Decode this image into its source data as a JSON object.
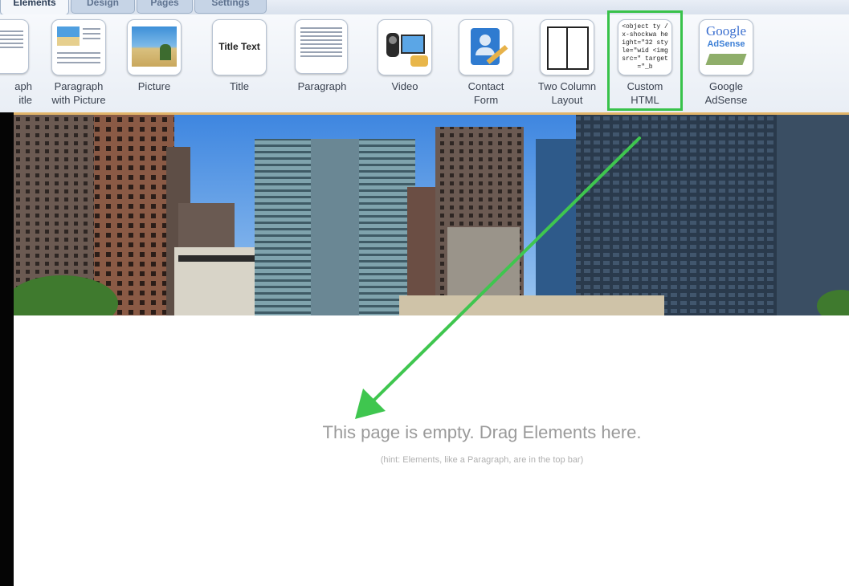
{
  "tabs": [
    "Elements",
    "Design",
    "Pages",
    "Settings"
  ],
  "toolbar": {
    "items": [
      {
        "label_1": "aph",
        "label_2": "itle",
        "icon": "paragraph-with-title-icon"
      },
      {
        "label_1": "Paragraph",
        "label_2": "with Picture",
        "icon": "paragraph-with-picture-icon"
      },
      {
        "label_1": "Picture",
        "label_2": "",
        "icon": "picture-icon"
      },
      {
        "label_1": "Title",
        "label_2": "",
        "icon": "title-icon",
        "thumb_text": "Title Text"
      },
      {
        "label_1": "Paragraph",
        "label_2": "",
        "icon": "paragraph-icon"
      },
      {
        "label_1": "Video",
        "label_2": "",
        "icon": "video-camera-icon"
      },
      {
        "label_1": "Contact",
        "label_2": "Form",
        "icon": "contact-form-icon"
      },
      {
        "label_1": "Two Column",
        "label_2": "Layout",
        "icon": "two-column-icon"
      },
      {
        "label_1": "Custom",
        "label_2": "HTML",
        "icon": "custom-html-icon",
        "thumb_text": "<object ty /x-shockwa height=\"32 style=\"wid <img src=\" target=\"_b"
      },
      {
        "label_1": "Google",
        "label_2": "AdSense",
        "icon": "google-adsense-icon",
        "thumb_text_1": "Google",
        "thumb_text_2": "AdSense"
      }
    ]
  },
  "canvas": {
    "empty_message": "This page is empty. Drag Elements here.",
    "hint": "(hint: Elements, like a Paragraph, are in the top bar)"
  },
  "colors": {
    "highlight": "#38c24a",
    "toolbar_border": "#e2b56a"
  }
}
